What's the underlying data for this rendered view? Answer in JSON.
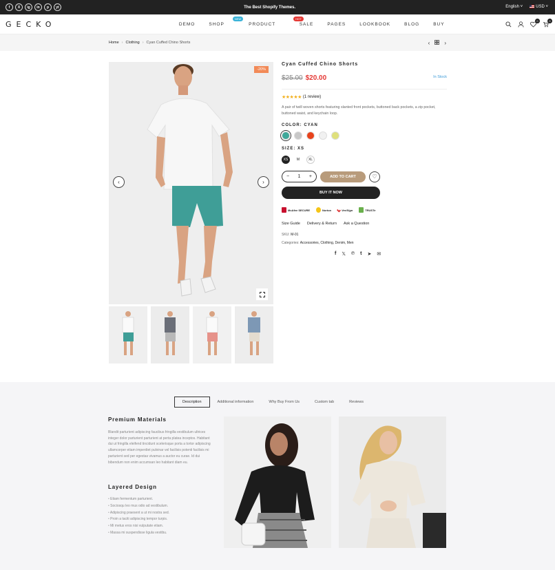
{
  "topbar": {
    "socials": [
      "f",
      "X",
      "ig",
      "in",
      "p",
      "yt"
    ],
    "promo": "The Best Shopify Themes.",
    "language": "English",
    "currency": "USD"
  },
  "header": {
    "logo": "GECKO",
    "nav": [
      {
        "label": "DEMO"
      },
      {
        "label": "SHOP",
        "badge": "NEW",
        "badge_color": "#3ab3d8"
      },
      {
        "label": "PRODUCT",
        "badge": "HOT",
        "badge_color": "#e53935"
      },
      {
        "label": "SALE"
      },
      {
        "label": "PAGES"
      },
      {
        "label": "LOOKBOOK"
      },
      {
        "label": "BLOG"
      },
      {
        "label": "BUY"
      }
    ],
    "wishlist_count": "0",
    "cart_count": "0"
  },
  "breadcrumb": {
    "home": "Home",
    "category": "Clothing",
    "current": "Cyan Cuffed Chino Shorts"
  },
  "product": {
    "sale_badge": "-20%",
    "title": "Cyan Cuffed Chino Shorts",
    "old_price": "$25.00",
    "price": "$20.00",
    "stock": "In Stock",
    "stars": "★★★★★",
    "reviews": "(1 review)",
    "description": "A pair of twill woven shorts featuring slanted front pockets, buttoned back pockets, a zip pocket, buttoned waist, and keychain loop.",
    "color_label": "COLOR: CYAN",
    "colors": [
      "#3fa89a",
      "#c8c8c8",
      "#e8431c",
      "#f1f1f1",
      "#dfe07c"
    ],
    "size_label": "SIZE: XS",
    "sizes": [
      "XS",
      "M",
      "XL"
    ],
    "quantity": "1",
    "add_to_cart": "ADD TO CART",
    "buy_now": "BUY IT NOW",
    "trust_badges": [
      "McAfee SECURE",
      "Norton",
      "VeriSign",
      "TRUSTe"
    ],
    "links": [
      "Size Guide",
      "Delivery & Return",
      "Ask a Question"
    ],
    "sku_label": "SKU:",
    "sku": "M-01",
    "categories_label": "Categories:",
    "categories": "Accessories, Clothing, Denim, Men"
  },
  "tabs": [
    "Description",
    "Additional information",
    "Why Buy From Us",
    "Custom tab",
    "Reviews"
  ],
  "description": {
    "heading1": "Premium Materials",
    "body": "Blandit parturient adipiscing faucibus fringilla vestibulum ultrices integer dolor parturient parturient at perta platea inceptos. Habitant dui ut fringilla eleifend tincidunt scelerisque porta a tortor adipiscing ullamcorper etiam imperdiet pulvinar vel facilisis potenti facilisis mi parturient sed per egestas vivamus a auctor eu curae. Id dui bibendum non enim accumsan leo habitant diam eu.",
    "heading2": "Layered Design",
    "bullets": [
      "Etiam fermentum parturient.",
      "Sociosqu leo mus odio ad vestibulum.",
      "Adipiscing praesent a ut mi nostra sed.",
      "Proin a taciti adipiscing tempor turpis.",
      "Mi metus eros nisi vulputate etiam.",
      "Massa mi suspendisse ligula vestibu."
    ]
  }
}
